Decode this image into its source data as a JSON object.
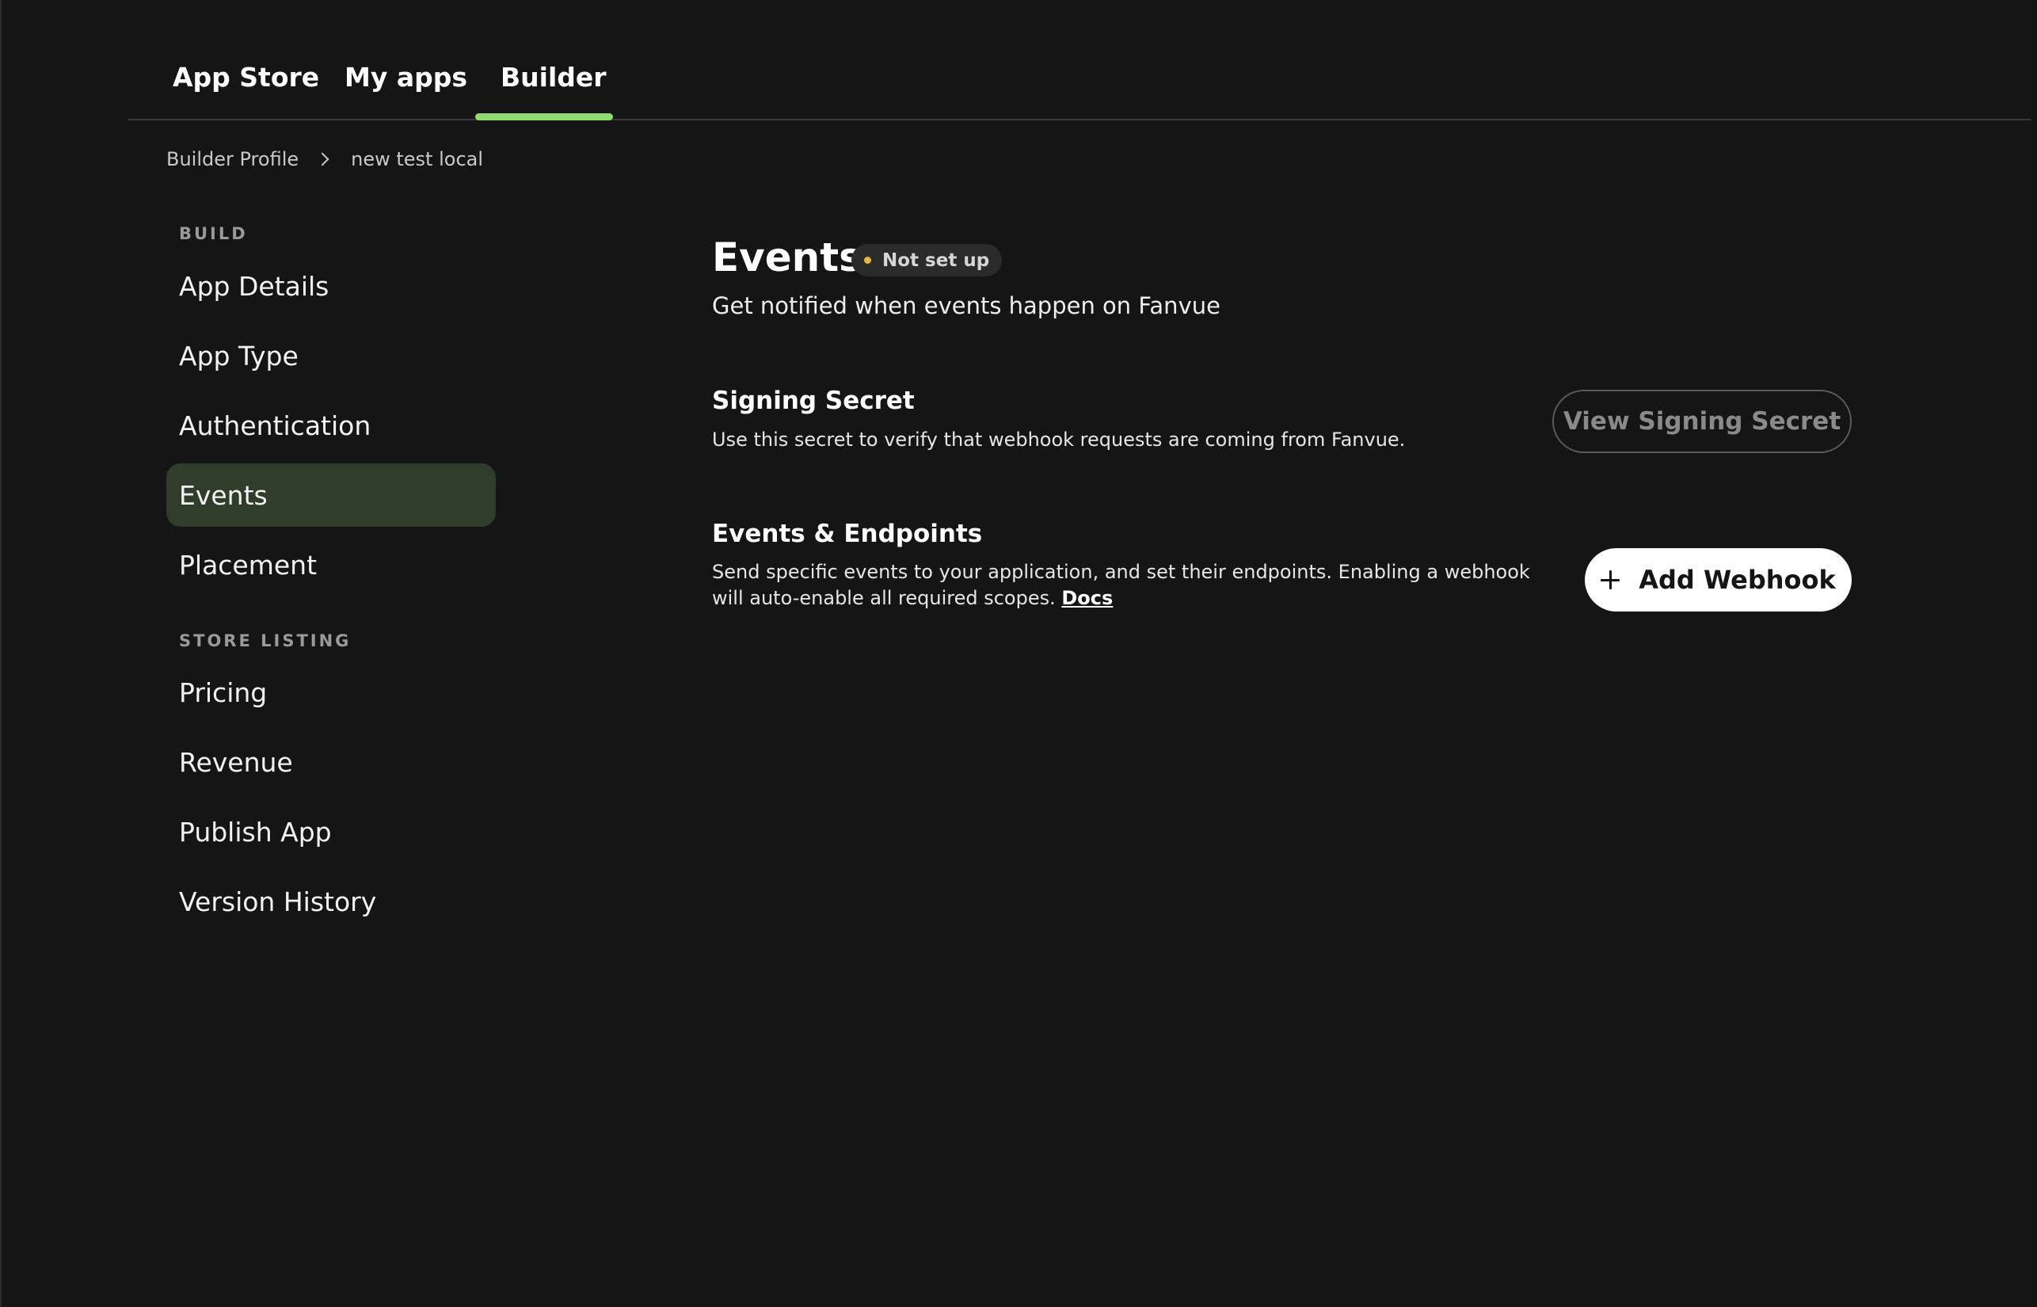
{
  "tabs": [
    {
      "label": "App Store"
    },
    {
      "label": "My apps"
    },
    {
      "label": "Builder"
    }
  ],
  "breadcrumb": {
    "parent": "Builder Profile",
    "current": "new test local"
  },
  "sidebar": {
    "build_label": "BUILD",
    "build_items": [
      {
        "label": "App Details"
      },
      {
        "label": "App Type"
      },
      {
        "label": "Authentication"
      },
      {
        "label": "Events"
      },
      {
        "label": "Placement"
      }
    ],
    "store_label": "STORE LISTING",
    "store_items": [
      {
        "label": "Pricing"
      },
      {
        "label": "Revenue"
      },
      {
        "label": "Publish App"
      },
      {
        "label": "Version History"
      }
    ]
  },
  "main": {
    "title": "Events",
    "status_badge": "Not set up",
    "subtitle": "Get notified when events happen on Fanvue",
    "signing": {
      "title": "Signing Secret",
      "description": "Use this secret to verify that webhook requests are coming from Fanvue.",
      "button_label": "View Signing Secret"
    },
    "endpoints": {
      "title": "Events & Endpoints",
      "description": "Send specific events to your application, and set their endpoints. Enabling a webhook will auto-enable all required scopes.",
      "docs_link": "Docs",
      "button_label": "Add Webhook"
    }
  },
  "colors": {
    "background": "#151515",
    "accent": "#8fdc6e",
    "active_nav_bg": "#2f3d2a",
    "status_dot": "#e8b93b"
  },
  "icons": [
    "chevron-right-icon",
    "status-dot-icon",
    "plus-icon"
  ]
}
